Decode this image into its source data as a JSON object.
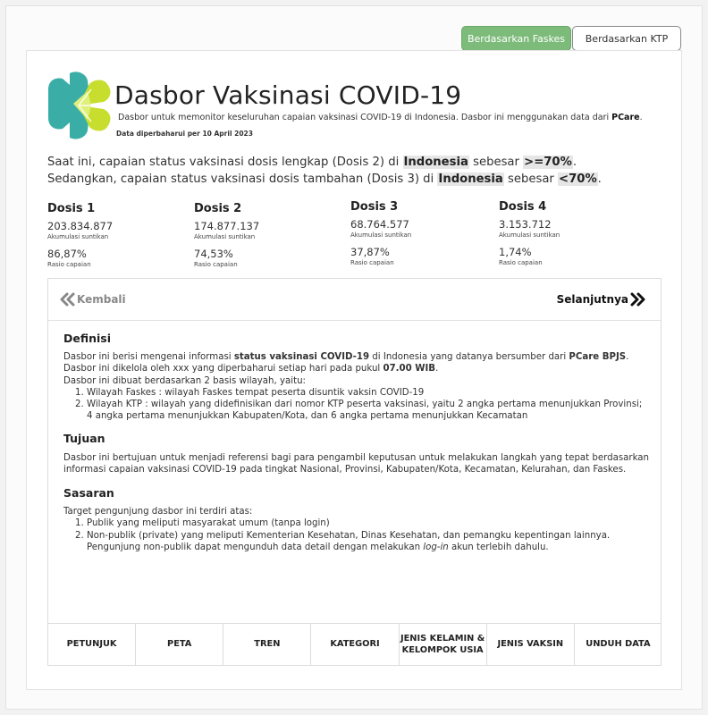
{
  "toggles": {
    "active_label": "Berdasarkan Faskes",
    "inactive_label": "Berdasarkan KTP"
  },
  "header": {
    "title": "Dasbor Vaksinasi COVID-19",
    "subtitle_prefix": "Dasbor untuk memonitor keseluruhan capaian vaksinasi COVID-19 di Indonesia. Dasbor ini menggunakan data dari ",
    "subtitle_bold": "PCare",
    "subtitle_suffix": ".",
    "updated": "Data diperbaharui per 10 April 2023"
  },
  "statement": {
    "line1_a": "Saat ini, capaian status vaksinasi dosis lengkap (Dosis 2) di ",
    "line1_region": "Indonesia",
    "line1_b": " sebesar ",
    "line1_value": ">=70%",
    "line1_c": ".",
    "line2_a": "Sedangkan, capaian status vaksinasi dosis tambahan (Dosis 3) di ",
    "line2_region": "Indonesia",
    "line2_b": " sebesar ",
    "line2_value": "<70%",
    "line2_c": "."
  },
  "doses": [
    {
      "name": "Dosis 1",
      "value": "203.834.877",
      "value_label": "Akumulasi suntikan",
      "ratio": "86,87%",
      "ratio_label": "Rasio capaian"
    },
    {
      "name": "Dosis 2",
      "value": "174.877.137",
      "value_label": "Akumulasi suntikan",
      "ratio": "74,53%",
      "ratio_label": "Rasio capaian"
    },
    {
      "name": "Dosis 3",
      "value": "68.764.577",
      "value_label": "Akumulasi suntikan",
      "ratio": "37,87%",
      "ratio_label": "Rasio capaian"
    },
    {
      "name": "Dosis 4",
      "value": "3.153.712",
      "value_label": "Akumulasi suntikan",
      "ratio": "1,74%",
      "ratio_label": "Rasio capaian"
    }
  ],
  "nav": {
    "back": "Kembali",
    "next": "Selanjutnya"
  },
  "definisi": {
    "heading": "Definisi",
    "p1_a": "Dasbor ini berisi mengenai informasi ",
    "p1_b": "status vaksinasi COVID-19",
    "p1_c": " di Indonesia yang datanya bersumber dari ",
    "p1_d": "PCare BPJS",
    "p1_e": ". Dasbor ini dikelola oleh xxx yang diperbaharui setiap hari pada pukul ",
    "p1_f": "07.00 WIB",
    "p1_g": ".",
    "p2": "Dasbor ini dibuat berdasarkan 2 basis wilayah, yaitu:",
    "items": [
      "Wilayah Faskes : wilayah Faskes tempat peserta disuntik vaksin COVID-19",
      "Wilayah KTP : wilayah yang didefinisikan dari nomor KTP peserta vaksinasi, yaitu 2 angka pertama menunjukkan Provinsi; 4 angka pertama menunjukkan Kabupaten/Kota, dan 6 angka pertama menunjukkan Kecamatan"
    ]
  },
  "tujuan": {
    "heading": "Tujuan",
    "text": "Dasbor ini bertujuan untuk menjadi referensi bagi para pengambil keputusan untuk melakukan langkah yang tepat berdasarkan informasi capaian vaksinasi COVID-19 pada tingkat Nasional, Provinsi, Kabupaten/Kota, Kecamatan, Kelurahan, dan Faskes."
  },
  "sasaran": {
    "heading": "Sasaran",
    "intro": "Target pengunjung dasbor ini terdiri atas:",
    "item1": "Publik yang meliputi masyarakat umum (tanpa login)",
    "item2_a": "Non-publik (private) yang meliputi Kementerian Kesehatan, Dinas Kesehatan, dan pemangku kepentingan lainnya. Pengunjung non-publik dapat mengunduh data detail dengan melakukan ",
    "item2_em": "log-in",
    "item2_b": " akun terlebih dahulu."
  },
  "tabs": [
    "PETUNJUK",
    "PETA",
    "TREN",
    "KATEGORI",
    "JENIS KELAMIN & KELOMPOK USIA",
    "JENIS VAKSIN",
    "UNDUH DATA"
  ],
  "colors": {
    "brand_teal": "#3aaea6",
    "brand_green": "#c8de2e",
    "toggle_active": "#7dbb7b"
  }
}
